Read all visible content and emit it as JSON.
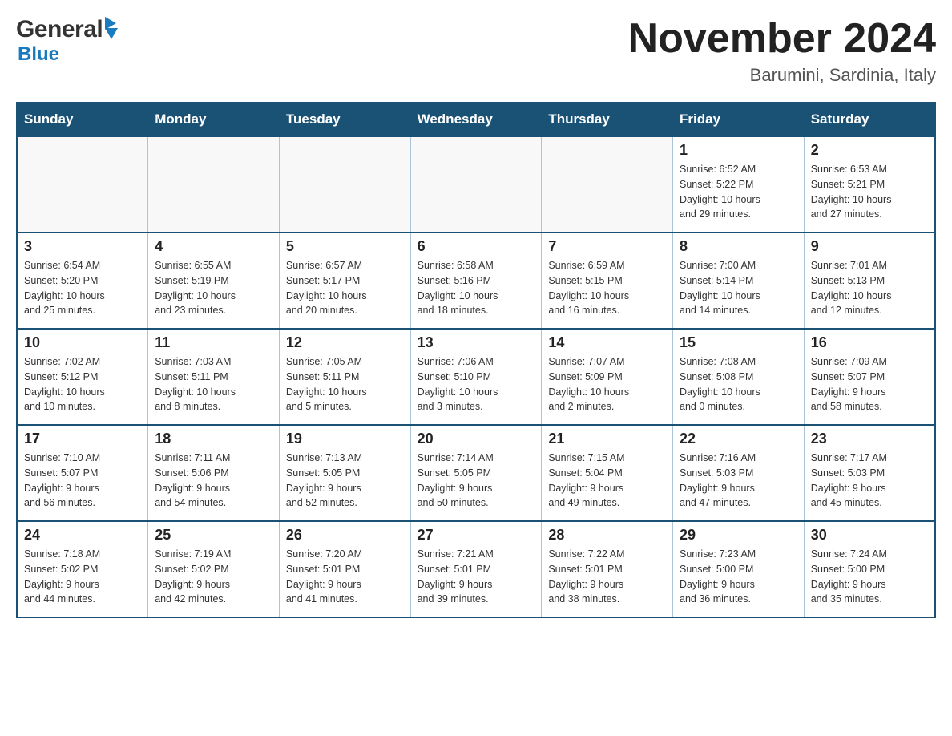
{
  "header": {
    "logo": {
      "general": "General",
      "blue": "Blue"
    },
    "title": "November 2024",
    "location": "Barumini, Sardinia, Italy"
  },
  "calendar": {
    "days_of_week": [
      "Sunday",
      "Monday",
      "Tuesday",
      "Wednesday",
      "Thursday",
      "Friday",
      "Saturday"
    ],
    "weeks": [
      {
        "days": [
          {
            "number": "",
            "info": ""
          },
          {
            "number": "",
            "info": ""
          },
          {
            "number": "",
            "info": ""
          },
          {
            "number": "",
            "info": ""
          },
          {
            "number": "",
            "info": ""
          },
          {
            "number": "1",
            "info": "Sunrise: 6:52 AM\nSunset: 5:22 PM\nDaylight: 10 hours\nand 29 minutes."
          },
          {
            "number": "2",
            "info": "Sunrise: 6:53 AM\nSunset: 5:21 PM\nDaylight: 10 hours\nand 27 minutes."
          }
        ]
      },
      {
        "days": [
          {
            "number": "3",
            "info": "Sunrise: 6:54 AM\nSunset: 5:20 PM\nDaylight: 10 hours\nand 25 minutes."
          },
          {
            "number": "4",
            "info": "Sunrise: 6:55 AM\nSunset: 5:19 PM\nDaylight: 10 hours\nand 23 minutes."
          },
          {
            "number": "5",
            "info": "Sunrise: 6:57 AM\nSunset: 5:17 PM\nDaylight: 10 hours\nand 20 minutes."
          },
          {
            "number": "6",
            "info": "Sunrise: 6:58 AM\nSunset: 5:16 PM\nDaylight: 10 hours\nand 18 minutes."
          },
          {
            "number": "7",
            "info": "Sunrise: 6:59 AM\nSunset: 5:15 PM\nDaylight: 10 hours\nand 16 minutes."
          },
          {
            "number": "8",
            "info": "Sunrise: 7:00 AM\nSunset: 5:14 PM\nDaylight: 10 hours\nand 14 minutes."
          },
          {
            "number": "9",
            "info": "Sunrise: 7:01 AM\nSunset: 5:13 PM\nDaylight: 10 hours\nand 12 minutes."
          }
        ]
      },
      {
        "days": [
          {
            "number": "10",
            "info": "Sunrise: 7:02 AM\nSunset: 5:12 PM\nDaylight: 10 hours\nand 10 minutes."
          },
          {
            "number": "11",
            "info": "Sunrise: 7:03 AM\nSunset: 5:11 PM\nDaylight: 10 hours\nand 8 minutes."
          },
          {
            "number": "12",
            "info": "Sunrise: 7:05 AM\nSunset: 5:11 PM\nDaylight: 10 hours\nand 5 minutes."
          },
          {
            "number": "13",
            "info": "Sunrise: 7:06 AM\nSunset: 5:10 PM\nDaylight: 10 hours\nand 3 minutes."
          },
          {
            "number": "14",
            "info": "Sunrise: 7:07 AM\nSunset: 5:09 PM\nDaylight: 10 hours\nand 2 minutes."
          },
          {
            "number": "15",
            "info": "Sunrise: 7:08 AM\nSunset: 5:08 PM\nDaylight: 10 hours\nand 0 minutes."
          },
          {
            "number": "16",
            "info": "Sunrise: 7:09 AM\nSunset: 5:07 PM\nDaylight: 9 hours\nand 58 minutes."
          }
        ]
      },
      {
        "days": [
          {
            "number": "17",
            "info": "Sunrise: 7:10 AM\nSunset: 5:07 PM\nDaylight: 9 hours\nand 56 minutes."
          },
          {
            "number": "18",
            "info": "Sunrise: 7:11 AM\nSunset: 5:06 PM\nDaylight: 9 hours\nand 54 minutes."
          },
          {
            "number": "19",
            "info": "Sunrise: 7:13 AM\nSunset: 5:05 PM\nDaylight: 9 hours\nand 52 minutes."
          },
          {
            "number": "20",
            "info": "Sunrise: 7:14 AM\nSunset: 5:05 PM\nDaylight: 9 hours\nand 50 minutes."
          },
          {
            "number": "21",
            "info": "Sunrise: 7:15 AM\nSunset: 5:04 PM\nDaylight: 9 hours\nand 49 minutes."
          },
          {
            "number": "22",
            "info": "Sunrise: 7:16 AM\nSunset: 5:03 PM\nDaylight: 9 hours\nand 47 minutes."
          },
          {
            "number": "23",
            "info": "Sunrise: 7:17 AM\nSunset: 5:03 PM\nDaylight: 9 hours\nand 45 minutes."
          }
        ]
      },
      {
        "days": [
          {
            "number": "24",
            "info": "Sunrise: 7:18 AM\nSunset: 5:02 PM\nDaylight: 9 hours\nand 44 minutes."
          },
          {
            "number": "25",
            "info": "Sunrise: 7:19 AM\nSunset: 5:02 PM\nDaylight: 9 hours\nand 42 minutes."
          },
          {
            "number": "26",
            "info": "Sunrise: 7:20 AM\nSunset: 5:01 PM\nDaylight: 9 hours\nand 41 minutes."
          },
          {
            "number": "27",
            "info": "Sunrise: 7:21 AM\nSunset: 5:01 PM\nDaylight: 9 hours\nand 39 minutes."
          },
          {
            "number": "28",
            "info": "Sunrise: 7:22 AM\nSunset: 5:01 PM\nDaylight: 9 hours\nand 38 minutes."
          },
          {
            "number": "29",
            "info": "Sunrise: 7:23 AM\nSunset: 5:00 PM\nDaylight: 9 hours\nand 36 minutes."
          },
          {
            "number": "30",
            "info": "Sunrise: 7:24 AM\nSunset: 5:00 PM\nDaylight: 9 hours\nand 35 minutes."
          }
        ]
      }
    ]
  }
}
